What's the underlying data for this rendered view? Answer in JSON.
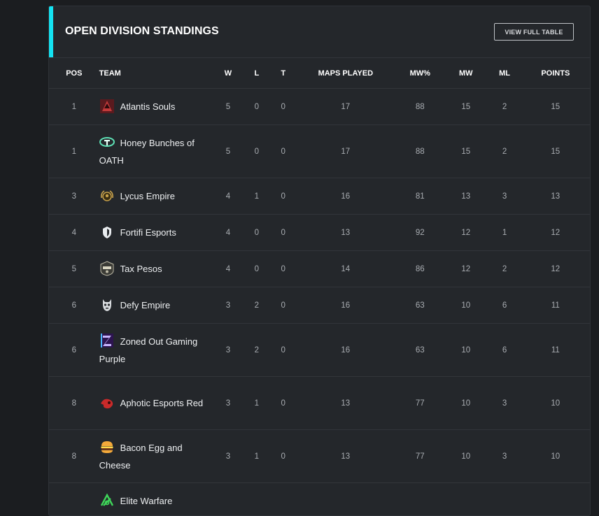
{
  "header": {
    "title": "OPEN DIVISION STANDINGS",
    "view_full_table": "VIEW FULL TABLE"
  },
  "columns": {
    "pos": "POS",
    "team": "TEAM",
    "w": "W",
    "l": "L",
    "t": "T",
    "maps_played": "MAPS PLAYED",
    "mw_pct": "MW%",
    "mw": "MW",
    "ml": "ML",
    "points": "POINTS"
  },
  "rows": [
    {
      "pos": "1",
      "team": "Atlantis Souls",
      "w": "5",
      "l": "0",
      "t": "0",
      "maps": "17",
      "mwp": "88",
      "mw": "15",
      "ml": "2",
      "pts": "15",
      "logo": "atlantis-souls-logo-icon"
    },
    {
      "pos": "1",
      "team": "Honey Bunches of OATH",
      "w": "5",
      "l": "0",
      "t": "0",
      "maps": "17",
      "mwp": "88",
      "mw": "15",
      "ml": "2",
      "pts": "15",
      "logo": "oath-logo-icon"
    },
    {
      "pos": "3",
      "team": "Lycus Empire",
      "w": "4",
      "l": "1",
      "t": "0",
      "maps": "16",
      "mwp": "81",
      "mw": "13",
      "ml": "3",
      "pts": "13",
      "logo": "lycus-empire-logo-icon"
    },
    {
      "pos": "4",
      "team": "Fortifi Esports",
      "w": "4",
      "l": "0",
      "t": "0",
      "maps": "13",
      "mwp": "92",
      "mw": "12",
      "ml": "1",
      "pts": "12",
      "logo": "fortifi-logo-icon"
    },
    {
      "pos": "5",
      "team": "Tax Pesos",
      "w": "4",
      "l": "0",
      "t": "0",
      "maps": "14",
      "mwp": "86",
      "mw": "12",
      "ml": "2",
      "pts": "12",
      "logo": "tax-pesos-logo-icon"
    },
    {
      "pos": "6",
      "team": "Defy Empire",
      "w": "3",
      "l": "2",
      "t": "0",
      "maps": "16",
      "mwp": "63",
      "mw": "10",
      "ml": "6",
      "pts": "11",
      "logo": "defy-empire-logo-icon"
    },
    {
      "pos": "6",
      "team": "Zoned Out Gaming Purple",
      "w": "3",
      "l": "2",
      "t": "0",
      "maps": "16",
      "mwp": "63",
      "mw": "10",
      "ml": "6",
      "pts": "11",
      "logo": "zoned-out-logo-icon"
    },
    {
      "pos": "8",
      "team": "Aphotic Esports Red",
      "w": "3",
      "l": "1",
      "t": "0",
      "maps": "13",
      "mwp": "77",
      "mw": "10",
      "ml": "3",
      "pts": "10",
      "logo": "aphotic-logo-icon"
    },
    {
      "pos": "8",
      "team": "Bacon Egg and Cheese",
      "w": "3",
      "l": "1",
      "t": "0",
      "maps": "13",
      "mwp": "77",
      "mw": "10",
      "ml": "3",
      "pts": "10",
      "logo": "burger-logo-icon"
    },
    {
      "pos": "",
      "team": "Elite Warfare",
      "w": "",
      "l": "",
      "t": "",
      "maps": "",
      "mwp": "",
      "mw": "",
      "ml": "",
      "pts": "",
      "logo": "elite-warfare-logo-icon"
    }
  ],
  "colors": {
    "accent": "#14e3f2",
    "panel_bg": "#24272b",
    "page_bg": "#1b1d20"
  }
}
